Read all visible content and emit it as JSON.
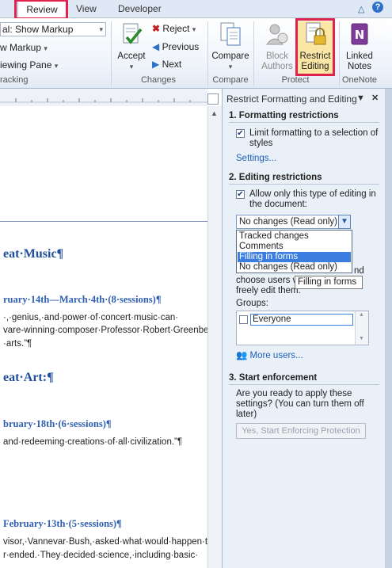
{
  "ribbon": {
    "tabs": [
      "Review",
      "View",
      "Developer"
    ],
    "active_tab": "Review",
    "window_controls": [
      "△",
      "?"
    ],
    "combo_value": "al: Show Markup",
    "show_markup": "w Markup",
    "reviewing_pane": "iewing Pane",
    "tracking_label": "racking",
    "accept_label": "Accept",
    "reject_label": "Reject",
    "previous_label": "Previous",
    "next_label": "Next",
    "changes_label": "Changes",
    "compare_label": "Compare",
    "compare_group": "Compare",
    "block_authors": [
      "Block",
      "Authors"
    ],
    "restrict_editing": [
      "Restrict",
      "Editing"
    ],
    "protect_group": "Protect",
    "linked_notes": [
      "Linked",
      "Notes"
    ],
    "onenote_group": "OneNote"
  },
  "document": {
    "heading1": "eat·Music¶",
    "sub1": "ruary·14th—March·4th·(8·sessions)¶",
    "body1": [
      "·,·genius,·and·power·of·concert·music·can·",
      "vare-winning·composer·Professor·Robert·Greenbe",
      "·arts.”¶"
    ],
    "heading2": "eat·Art:¶",
    "sub2": "bruary·18th·(6·sessions)¶",
    "body2": "and·redeeming·creations·of·all·civilization.”¶",
    "sub3": "February·13th·(5·sessions)¶",
    "body3": [
      "visor,·Vannevar·Bush,·asked·what·would·happen·t",
      "r·ended.·They·decided·science,·including·basic·"
    ]
  },
  "pane": {
    "title": "Restrict Formatting and Editing",
    "section1_title": "1. Formatting restrictions",
    "limit_formatting": [
      "Limit formatting to a selection of",
      "styles"
    ],
    "settings_link": "Settings...",
    "section2_title": "2. Editing restrictions",
    "allow_only": [
      "Allow only this type of editing in",
      "the document:"
    ],
    "editing_type_value": "No changes (Read only)",
    "editing_options": [
      "Tracked changes",
      "Comments",
      "Filling in forms",
      "No changes (Read only)"
    ],
    "highlighted_option": "Filling in forms",
    "tooltip": "Filling in forms",
    "exceptions_partial": [
      "nd",
      "choose users w",
      "freely edit them."
    ],
    "groups_label": "Groups:",
    "everyone": "Everyone",
    "more_users": "More users...",
    "section3_title": "3. Start enforcement",
    "enforce_text": [
      "Are you ready to apply these",
      "settings? (You can turn them off",
      "later)"
    ],
    "enforce_button": "Yes, Start Enforcing Protection"
  },
  "colors": {
    "highlight_box": "#e0234d",
    "selection": "#3c7ee0",
    "heading_blue": "#1f4e9c",
    "link_blue": "#1f5fb8"
  }
}
